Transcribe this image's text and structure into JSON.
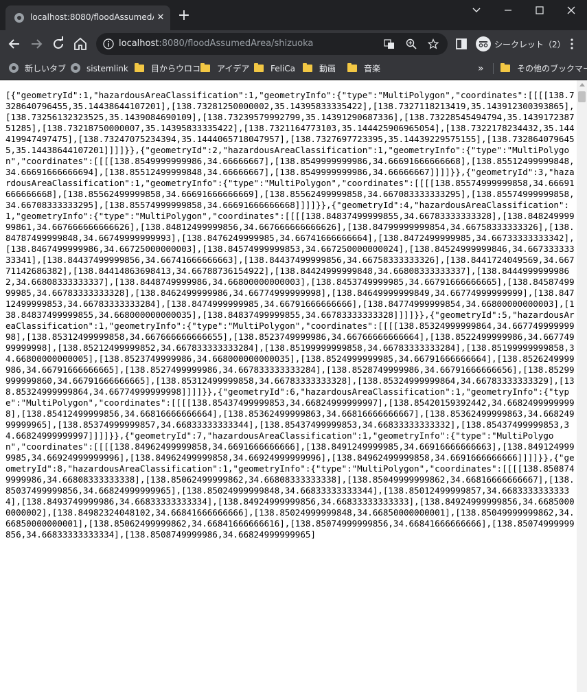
{
  "tab": {
    "title": "localhost:8080/floodAssumedAre",
    "close_glyph": "✕",
    "favicon": "globe-icon"
  },
  "new_tab_glyph": "+",
  "omnibox": {
    "host": "localhost",
    "rest": ":8080/floodAssumedArea/shizuoka"
  },
  "incognito": {
    "label": "シークレット（2）"
  },
  "bookmarks": {
    "items": [
      "新しいタブ",
      "sistemlink",
      "目からウロコ",
      "アイデア",
      "FeliCa",
      "動画",
      "音楽"
    ],
    "more_glyph": "»",
    "other": "その他のブックマーク"
  },
  "colors": {
    "frame": "#202124",
    "toolbar": "#35363a",
    "folder": "#f2c744",
    "page_bg": "#ffffff"
  },
  "content": {
    "json_text": "[{\"geometryId\":1,\"hazardousAreaClassification\":1,\"geometryInfo\":{\"type\":\"MultiPolygon\",\"coordinates\":[[[[138.7328640796455,35.14438644107201],[138.73281250000002,35.14395833335422],[138.7327118213419,35.143912300393865],[138.73256132323525,35.1439084690109],[138.73239579992799,35.14391290687336],[138.73228545494794,35.143917238751285],[138.73218750000007,35.14395833335422],[138.7321164773103,35.144425906965054],[138.7322178234432,35.144419947497475],[138.73247075234394,35.1444065718047957],[138.7327697723395,35.14439229575155],[138.7328640796455,35.14438644107201]]]]}},{\"geometryId\":2,\"hazardousAreaClassification\":1,\"geometryInfo\":{\"type\":\"MultiPolygon\",\"coordinates\":[[[[138.8549999999986,34.66666667],[138.8549999999986,34.66691666666668],[138.85512499999848,34.66691666666694],[138.85512499999848,34.66666667],[138.8549999999986,34.66666667]]]]}},{\"geometryId\":3,\"hazardousAreaClassification\":1,\"geometryInfo\":{\"type\":\"MultiPolygon\",\"coordinates\":[[[[138.85574999999858,34.66691666666668],[138.85562499999858,34.66691666666669],[138.85562499999858,34.667083333333295],[138.85574999999858,34.66708333333295],[138.85574999999858,34.66691666666668]]]]}},{\"geometryId\":4,\"hazardousAreaClassification\":1,\"geometryInfo\":{\"type\":\"MultiPolygon\",\"coordinates\":[[[[138.84837499999855,34.66783333333328],[138.84824999999861,34.667666666666626],[138.84812499999856,34.667666666666626],[138.84799999999854,34.66758333333326],[138.84787499999848,34.66749999999993],[138.8476249999985,34.66741666666664],[138.8472499999985,34.66733333333342],[138.8467499999986,34.66725000000003],[138.84574999999853,34.667250000000024],[138.84524999999846,34.66733333333341],[138.84437499999856,34.66741666666663],[138.84437499999856,34.66758333333326],[138.8441724049569,34.66771142686382],[138.84414863698413,34.66788736154922],[138.84424999999848,34.66808333333337],[138.84449999999862,34.66808333333337],[138.8448749999986,34.66800000000003],[138.8453749999985,34.66791666666665],[138.8458749999985,34.66783333333328],[138.8462499999986,34.66774999999998],[138.84649999999849,34.66774999999999],[138.84712499999853,34.66783333333284],[138.8474999999985,34.66791666666666],[138.84774999999854,34.66800000000003],[138.84837499999855,34.668000000000035],[138.84837499999855,34.66783333333328]]]]}},{\"geometryId\":5,\"hazardousAreaClassification\":1,\"geometryInfo\":{\"type\":\"MultiPolygon\",\"coordinates\":[[[[138.85324999999864,34.66774999999998],[138.85312499999858,34.667666666666655],[138.8523749999986,34.66766666666664],[138.8522499999986,34.66774999999998],[138.85212499999852,34.667833333333284],[138.85199999999858,34.66783333333284],[138.85199999999858,34.66800000000005],[138.8523749999986,34.668000000000035],[138.8524999999985,34.66791666666664],[138.8526249999986,34.66791666666665],[138.8527499999986,34.667833333333284],[138.8528749999986,34.66791666666656],[138.85299999999860,34.66791666666665],[138.85312499999858,34.66783333333328],[138.85324999999864,34.66783333333329],[138.85324999999864,34.66774999999998]]]]}},{\"geometryId\":6,\"hazardousAreaClassification\":1,\"geometryInfo\":{\"type\":\"MultiPolygon\",\"coordinates\":[[[[138.85437499999853,34.66824999999997],[138.85420159392442,34.66824999999998],[138.85412499999856,34.66816666666664],[138.85362499999863,34.66816666666667],[138.85362499999863,34.66824999999965],[138.85374999999857,34.66833333333344],[138.85437499999853,34.66833333333332],[138.85437499999853,34.66824999999997]]]]}},{\"geometryId\":7,\"hazardousAreaClassification\":1,\"geometryInfo\":{\"type\":\"MultiPolygon\",\"coordinates\":[[[[138.84962499999858,34.6691666666666],[138.8491249999985,34.66916666666663],[138.8491249999985,34.66924999999996],[138.84962499999858,34.66924999999996],[138.84962499999858,34.6691666666666]]]]}},{\"geometryId\":8,\"hazardousAreaClassification\":1,\"geometryInfo\":{\"type\":\"MultiPolygon\",\"coordinates\":[[[[138.8508749999986,34.66808333333338],[138.85062499999862,34.66808333333338],[138.85049999999862,34.66816666666667],[138.85037499999856,34.66824999999965],[138.85024999999848,34.66833333333344],[138.85012499999857,34.66833333333334],[138.8493749999986,34.66833333333334],[138.84924999999856,34.66833333333333],[138.84924999999856,34.66850000000002],[138.84982324048102,34.66841666666666],[138.85024999999848,34.66850000000001],[138.85049999999862,34.66850000000001],[138.85062499999862,34.66841666666616],[138.85074999999856,34.66841666666666],[138.85074999999856,34.66833333333334],[138.8508749999986,34.66824999999965]"
  }
}
